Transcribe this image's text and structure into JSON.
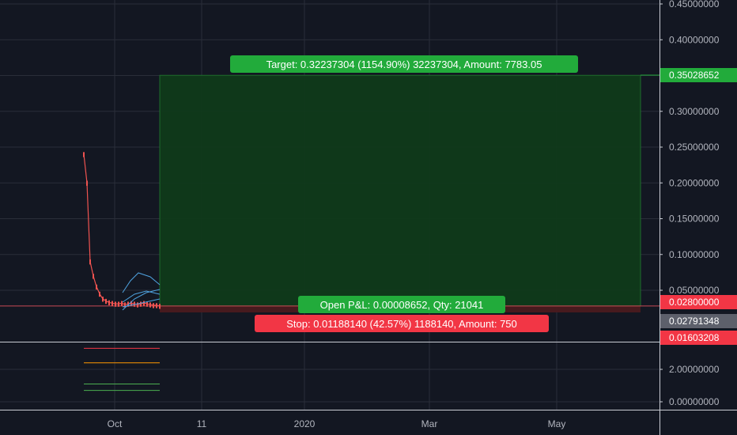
{
  "chart_data": {
    "type": "line",
    "title": "",
    "price_axis": {
      "ticks": [
        "0.45000000",
        "0.40000000",
        "0.35000000",
        "0.30000000",
        "0.25000000",
        "0.20000000",
        "0.15000000",
        "0.10000000",
        "0.05000000"
      ],
      "tick_values": [
        0.45,
        0.4,
        0.35,
        0.3,
        0.25,
        0.2,
        0.15,
        0.1,
        0.05
      ],
      "ylim": [
        0.0,
        0.46
      ]
    },
    "indicator_axis": {
      "ticks": [
        "2.00000000",
        "0.00000000"
      ],
      "tick_values": [
        2,
        0
      ],
      "ylim": [
        0,
        3.4
      ]
    },
    "time_axis": {
      "labels": [
        "Oct",
        "11",
        "2020",
        "Mar",
        "May"
      ]
    },
    "price_series": {
      "name": "",
      "color": "#ef5350",
      "x": [
        0,
        1,
        2,
        3,
        4,
        5,
        6,
        7,
        8,
        9,
        10,
        11,
        12,
        13,
        14,
        15,
        16,
        17,
        18,
        19,
        20,
        21,
        22,
        23,
        24
      ],
      "values": [
        0.24,
        0.2,
        0.09,
        0.07,
        0.055,
        0.045,
        0.038,
        0.035,
        0.033,
        0.032,
        0.031,
        0.031,
        0.032,
        0.03,
        0.031,
        0.032,
        0.031,
        0.03,
        0.031,
        0.032,
        0.031,
        0.03,
        0.029,
        0.029,
        0.028
      ]
    },
    "position": {
      "entry_price": 0.028,
      "target_price": 0.35028652,
      "stop_price": 0.01603208,
      "target_label": "Target: 0.32237304 (1154.90%) 32237304, Amount: 7783.05",
      "stop_label": "Stop: 0.01188140 (42.57%) 1188140, Amount: 750",
      "pnl_label": "Open P&L: 0.00008652, Qty: 21041",
      "target_color": "#089981",
      "stop_color": "#f23645"
    },
    "price_tags": [
      {
        "text": "0.35028652",
        "value": 0.35028652,
        "bg": "#22ab3b",
        "fg": "#ffffff"
      },
      {
        "text": "0.02800000",
        "value": 0.028,
        "bg": "#f23645",
        "fg": "#ffffff"
      },
      {
        "text": "0.02791348",
        "value": 0.02291348,
        "bg": "#5d606b",
        "fg": "#ffffff"
      },
      {
        "text": "0.01603208",
        "value": 0.0135,
        "bg": "#f23645",
        "fg": "#ffffff"
      }
    ],
    "indicator_lines": [
      {
        "value": 3.3,
        "color": "#f23645"
      },
      {
        "value": 2.4,
        "color": "#ff9800"
      },
      {
        "value": 1.1,
        "color": "#4caf50"
      },
      {
        "value": 0.7,
        "color": "#4caf50"
      }
    ],
    "grid": true,
    "colors": {
      "background": "#131722",
      "grid": "#2a2e39",
      "axis_text": "#b2b5be",
      "profit_zone": "#0f3a1a",
      "loss_zone": "#4a1a1f",
      "cone": "#4fa3e0"
    }
  }
}
